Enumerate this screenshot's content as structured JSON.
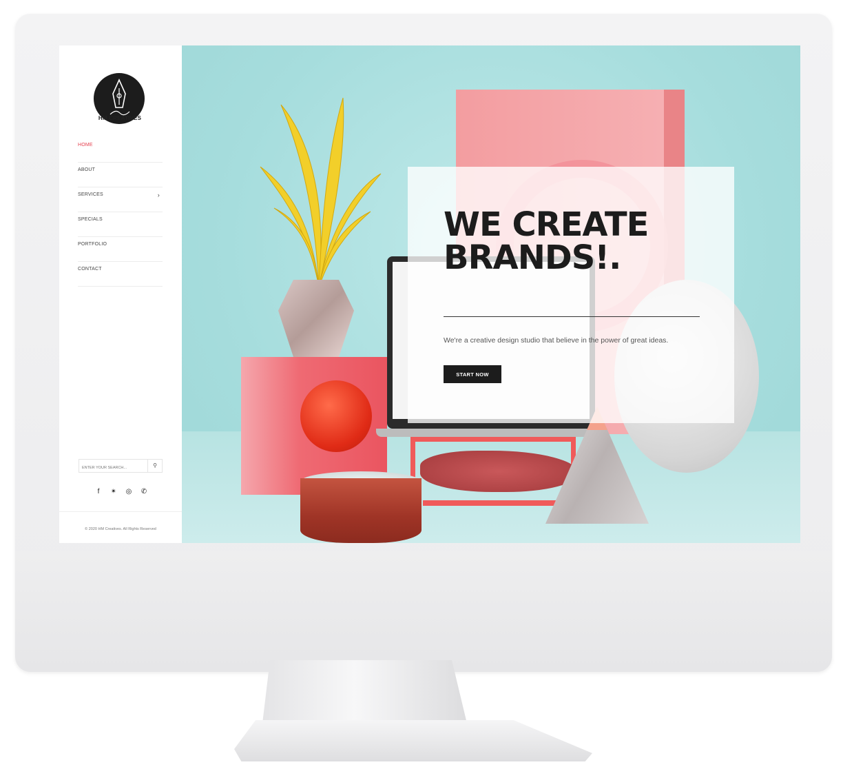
{
  "brand": {
    "name": "HM CREATIVES"
  },
  "sidebar": {
    "items": [
      {
        "label": "HOME"
      },
      {
        "label": "ABOUT"
      },
      {
        "label": "SERVICES",
        "chevron": "›"
      },
      {
        "label": "SPECIALS"
      },
      {
        "label": "PORTFOLIO"
      },
      {
        "label": "CONTACT"
      }
    ],
    "search": {
      "placeholder": "ENTER YOUR SEARCH...",
      "icon": "search-icon"
    },
    "social": {
      "facebook": "f",
      "twitter": "🐦",
      "instagram": "◎",
      "whatsapp": "✆"
    },
    "copyright": "© 2020 HM Creatives. All Rights Reserved"
  },
  "hero": {
    "headline_line1": "WE CREATE",
    "headline_line2": "BRANDS!.",
    "tagline": "We're a creative design studio that believe in the power of great ideas.",
    "cta_label": "START NOW"
  },
  "colors": {
    "accent": "#e5404f",
    "hero_bg": "#a6dddd",
    "dark": "#1c1c1c"
  }
}
